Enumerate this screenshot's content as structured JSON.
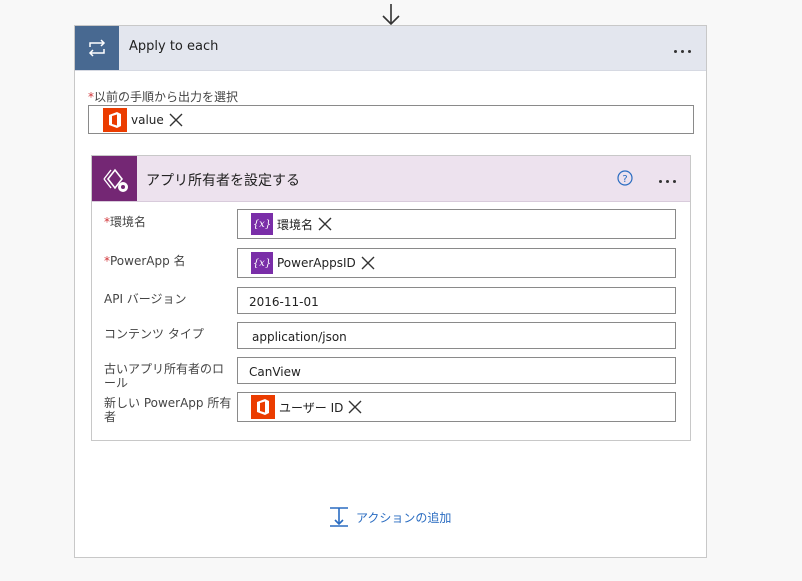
{
  "scope": {
    "title": "Apply to each",
    "select_output": {
      "required_mark": "*",
      "label": "以前の手順から出力を選択",
      "token_label": "value"
    }
  },
  "action": {
    "title": "アプリ所有者を設定する",
    "fields": [
      {
        "required_mark": "*",
        "label": "環境名",
        "token_label": "環境名",
        "token_type": "variable"
      },
      {
        "required_mark": "*",
        "label": "PowerApp 名",
        "token_label": "PowerAppsID",
        "token_type": "variable"
      },
      {
        "required_mark": "",
        "label": "API バージョン",
        "value": "2016-11-01"
      },
      {
        "required_mark": "",
        "label": "コンテンツ タイプ",
        "value": "application/json"
      },
      {
        "required_mark": "",
        "label": "古いアプリ所有者のロール",
        "value": "CanView"
      },
      {
        "required_mark": "",
        "label": "新しい PowerApp 所有者",
        "token_label": "ユーザー ID",
        "token_type": "office"
      }
    ]
  },
  "add_action_label": "アクションの追加",
  "colors": {
    "scope_header_bg": "#e3e6ee",
    "scope_icon_bg": "#486991",
    "action_header_bg": "#ede2ee",
    "action_icon_bg": "#742774",
    "variable_token": "#7a2ea8",
    "office_token": "#eb3c00",
    "link": "#2a6cc1",
    "required": "#d13438"
  },
  "icons": {
    "flow_arrow": "arrow-down-icon",
    "scope": "loop-icon",
    "office": "office-icon",
    "variable": "variable-icon",
    "remove": "close-icon",
    "help": "help-icon",
    "more": "more-options-icon",
    "add_action": "add-action-icon"
  }
}
